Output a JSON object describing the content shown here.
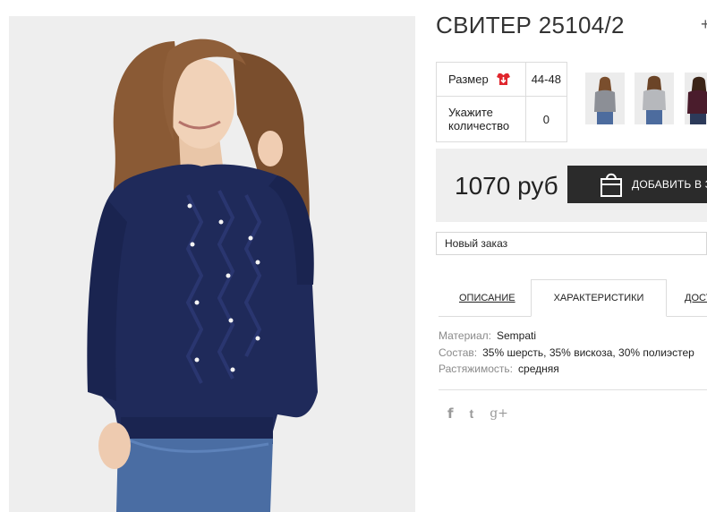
{
  "product": {
    "title": "СВИТЕР 25104/2",
    "title_edge": "+",
    "image_icon": "product-photo"
  },
  "specs": {
    "size_label": "Размер",
    "size_value": "44-48",
    "size_icon": "size-chart-icon",
    "quantity_label": "Укажите количество",
    "quantity_value": "0"
  },
  "thumbnails": [
    {
      "icon": "thumb-model-gray-1"
    },
    {
      "icon": "thumb-model-gray-2"
    },
    {
      "icon": "thumb-model-burgundy"
    }
  ],
  "purchase": {
    "price": "1070 руб",
    "cart_button_label": "ДОБАВИТЬ В ЗАКАЗ",
    "cart_icon": "shopping-bag-icon"
  },
  "order": {
    "selected": "Новый заказ"
  },
  "tabs": [
    {
      "label": "ОПИСАНИЕ"
    },
    {
      "label": "ХАРАКТЕРИСТИКИ"
    },
    {
      "label": "ДОСТАВКА"
    }
  ],
  "characteristics": [
    {
      "key": "Материал:",
      "value": "Sempati"
    },
    {
      "key": "Состав:",
      "value": "35% шерсть, 35% вискоза, 30% полиэстер"
    },
    {
      "key": "Растяжимость:",
      "value": "средняя"
    }
  ],
  "social": {
    "facebook": "f",
    "twitter": "t",
    "googleplus": "g+"
  },
  "colors": {
    "sweater": "#1f2a5a",
    "price_box": "#efefef",
    "button": "#2b2b2b",
    "size_icon": "#e0262d"
  }
}
